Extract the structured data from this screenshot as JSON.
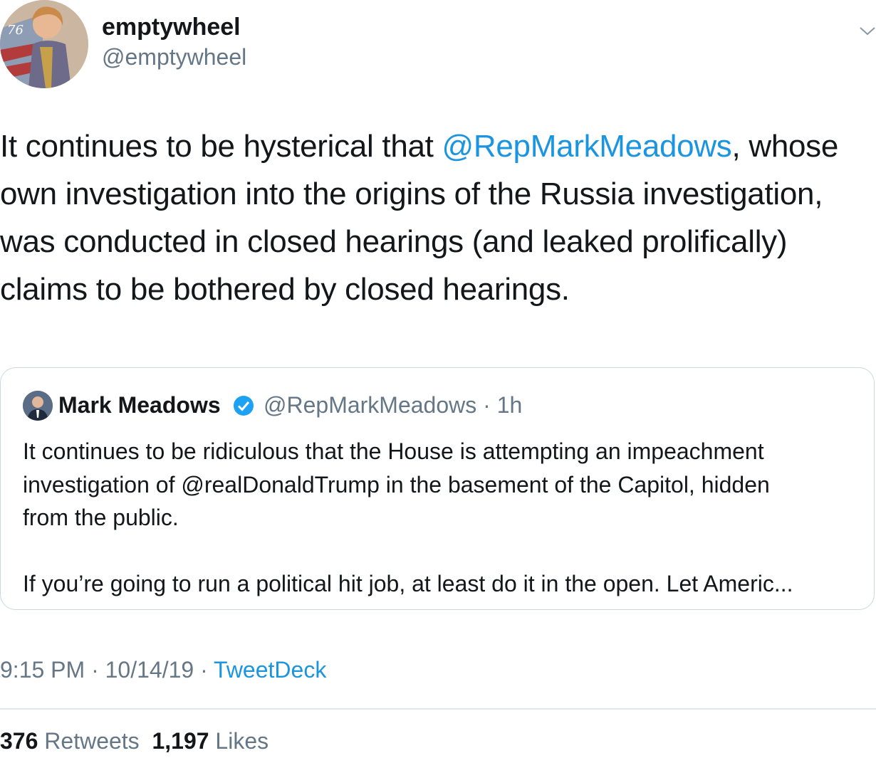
{
  "author": {
    "display_name": "emptywheel",
    "handle": "@emptywheel",
    "avatar_badge": "76"
  },
  "tweet": {
    "line1_pre": "It continues to be hysterical that ",
    "line1_mention": "@RepMarkMeadows",
    "line1_post": ", whose",
    "line2": "own investigation into the origins of the Russia investigation,",
    "line3": "was conducted in closed hearings (and leaked prolifically)",
    "line4": "claims to be bothered by closed hearings."
  },
  "quoted_tweet": {
    "display_name": "Mark Meadows",
    "handle_time": "@RepMarkMeadows · 1h",
    "line1": "It continues to be ridiculous that the House is attempting an impeachment",
    "line2": "investigation of @realDonaldTrump in the basement of the Capitol, hidden",
    "line3": "from the public.",
    "line4": "If you’re going to run a political hit job, at least do it in the open. Let Americ..."
  },
  "meta": {
    "time_date": "9:15 PM · 10/14/19 · ",
    "source": "TweetDeck"
  },
  "stats": {
    "retweets_count": "376",
    "retweets_label": "Retweets",
    "likes_count": "1,197",
    "likes_label": "Likes"
  },
  "colors": {
    "link": "#1b95e0",
    "secondary_text": "#657786",
    "border": "#ccd6dd",
    "verified": "#1da1f2"
  },
  "icons": {
    "caret": "chevron-down-icon",
    "verified": "verified-badge-icon"
  }
}
